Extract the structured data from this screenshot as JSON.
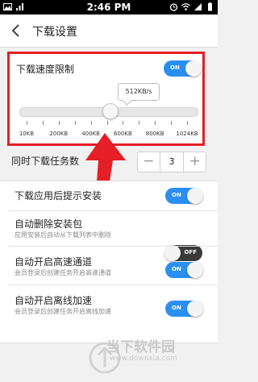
{
  "statusbar": {
    "time": "2:46 PM",
    "left_icons": [
      "picture-icon",
      "signal-bars-icon"
    ],
    "right_icons": [
      "alarm-icon",
      "wifi-icon",
      "cellular-icon",
      "battery-icon"
    ]
  },
  "header": {
    "title": "下载设置"
  },
  "speed_limit": {
    "label": "下载速度限制",
    "toggle": "ON",
    "current_value": "512KB/s",
    "slider_fraction": 0.52,
    "tick_labels": [
      "10KB",
      "200KB",
      "400KB",
      "600KB",
      "800KB",
      "1024KB"
    ]
  },
  "concurrent": {
    "label": "同时下载任务数",
    "minus": "−",
    "value": "3",
    "plus": "+"
  },
  "settings": [
    {
      "label": "下载应用后提示安装",
      "sub": "",
      "toggle": "ON"
    },
    {
      "label": "自动删除安装包",
      "sub": "应用安装后自动从下载列表中删除",
      "toggle": "OFF"
    },
    {
      "label": "自动开启高速通道",
      "sub": "会员登录后创建任务开启高速通道",
      "toggle": "ON"
    },
    {
      "label": "自动开启离线加速",
      "sub": "会员登录后创建任务开启离线加速",
      "toggle": "ON"
    }
  ],
  "watermark": {
    "text": "当下软件园",
    "url": "www.downxia.com"
  },
  "colors": {
    "accent": "#2a8ff0",
    "highlight": "#e61e26",
    "toggle_off": "#3a3a3a"
  }
}
